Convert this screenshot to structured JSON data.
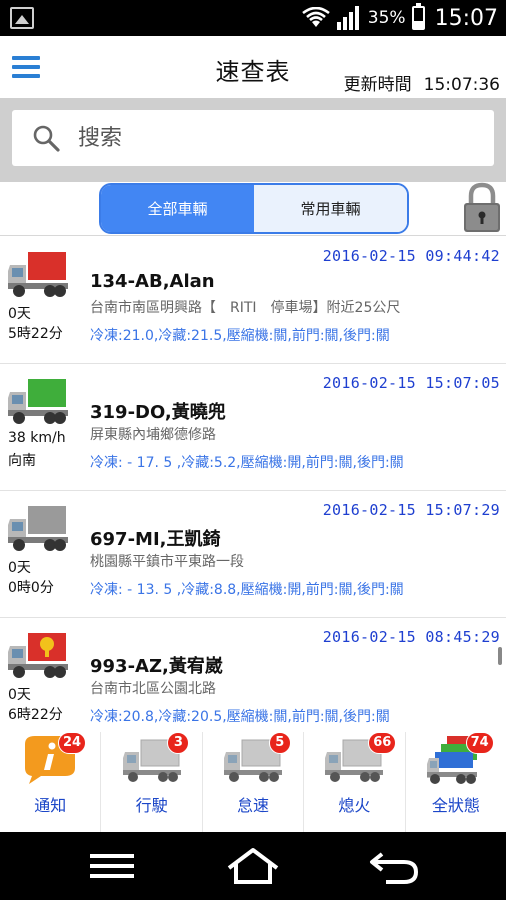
{
  "status_bar": {
    "battery": "35%",
    "time": "15:07"
  },
  "header": {
    "title": "速查表",
    "update_label": "更新時間",
    "update_time": "15:07:36"
  },
  "search": {
    "placeholder": "搜索"
  },
  "tabs": [
    {
      "label": "全部車輛",
      "active": true
    },
    {
      "label": "常用車輛",
      "active": false
    }
  ],
  "vehicles": [
    {
      "timestamp": "2016-02-15 09:44:42",
      "plate": "134-AB,Alan",
      "address": "台南市南區明興路【　RITI　停車場】附近25公尺",
      "sensors": "冷凍:21.0,冷藏:21.5,壓縮機:關,前門:關,後門:關",
      "status_line1": "0天",
      "status_line2": "5時22分",
      "truck_color": "#d9302a"
    },
    {
      "timestamp": "2016-02-15 15:07:05",
      "plate": "319-DO,黃曉兜",
      "address": "屏東縣內埔鄉德修路",
      "sensors": "冷凍: - 17. 5 ,冷藏:5.2,壓縮機:開,前門:關,後門:關",
      "status_line1": "38 km/h",
      "status_line2": "向南",
      "truck_color": "#3fae3b"
    },
    {
      "timestamp": "2016-02-15 15:07:29",
      "plate": "697-MI,王凱錡",
      "address": "桃園縣平鎮市平東路一段",
      "sensors": "冷凍: - 13. 5 ,冷藏:8.8,壓縮機:開,前門:關,後門:關",
      "status_line1": "0天",
      "status_line2": "0時0分",
      "truck_color": "#9a9a9a"
    },
    {
      "timestamp": "2016-02-15 08:45:29",
      "plate": "993-AZ,黃宥崴",
      "address": "台南市北區公園北路",
      "sensors": "冷凍:20.8,冷藏:20.5,壓縮機:關,前門:關,後門:關",
      "status_line1": "0天",
      "status_line2": "6時22分",
      "truck_color": "#d9302a"
    }
  ],
  "bottom_nav": [
    {
      "label": "通知",
      "badge": "24",
      "icon": "notification-icon"
    },
    {
      "label": "行駛",
      "badge": "3",
      "icon": "truck-icon"
    },
    {
      "label": "怠速",
      "badge": "5",
      "icon": "truck-icon"
    },
    {
      "label": "熄火",
      "badge": "66",
      "icon": "truck-icon"
    },
    {
      "label": "全狀態",
      "badge": "74",
      "icon": "multi-truck-icon"
    }
  ],
  "colors": {
    "accent": "#4286f3",
    "timestamp": "#1e3fd0",
    "sensor": "#3a74e6",
    "badge": "#e8251b",
    "nav_label": "#1b46c8"
  }
}
